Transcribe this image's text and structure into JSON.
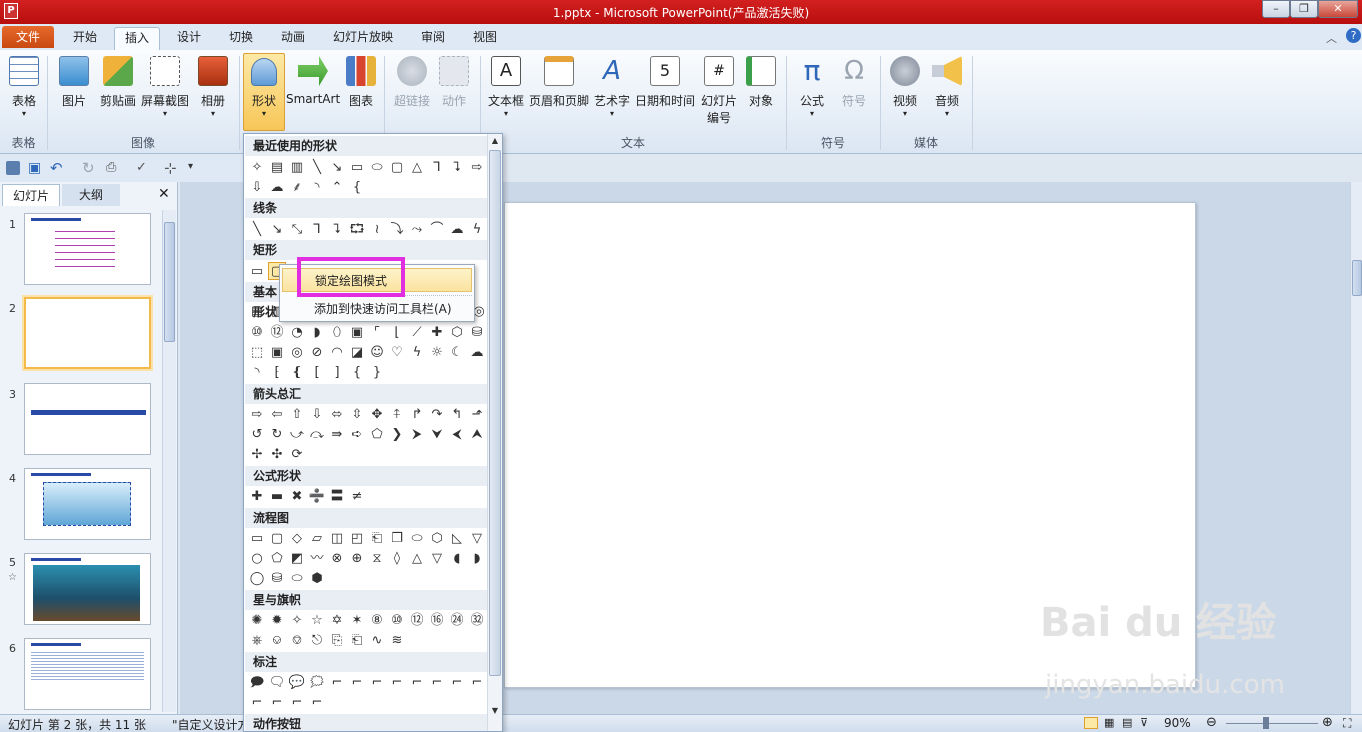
{
  "window": {
    "title": "1.pptx - Microsoft PowerPoint(产品激活失败)"
  },
  "tabs": {
    "file": "文件",
    "items": [
      "开始",
      "插入",
      "设计",
      "切换",
      "动画",
      "幻灯片放映",
      "审阅",
      "视图"
    ],
    "active": "插入"
  },
  "ribbon": {
    "buttons": {
      "table": "表格",
      "picture": "图片",
      "clipart": "剪贴画",
      "screenshot": "屏幕截图",
      "album": "相册",
      "shapes": "形状",
      "smartart": "SmartArt",
      "chart": "图表",
      "hyperlink": "超链接",
      "action": "动作",
      "textbox": "文本框",
      "headerfooter": "页眉和页脚",
      "wordart": "艺术字",
      "datetime": "日期和时间",
      "slidenum1": "幻灯片",
      "slidenum2": "编号",
      "object": "对象",
      "equation": "公式",
      "symbol": "符号",
      "video": "视频",
      "audio": "音频"
    },
    "groups": {
      "table": "表格",
      "image": "图像",
      "text": "文本",
      "symbols": "符号",
      "media": "媒体"
    }
  },
  "left_pane": {
    "tab_slides": "幻灯片",
    "tab_outline": "大纲",
    "slides": [
      "1",
      "2",
      "3",
      "4",
      "5",
      "6"
    ]
  },
  "gallery": {
    "sections": [
      "最近使用的形状",
      "线条",
      "矩形",
      "基本形状",
      "箭头总汇",
      "公式形状",
      "流程图",
      "星与旗帜",
      "标注",
      "动作按钮"
    ]
  },
  "context_menu": {
    "lock": "锁定绘图模式",
    "add_qat": "添加到快速访问工具栏(A)"
  },
  "status": {
    "slide_info": "幻灯片 第 2 张，共 11 张",
    "theme": "\"自定义设计方",
    "zoom": "90%"
  },
  "watermark": {
    "brand": "Bai du 经验",
    "url": "jingyan.baidu.com"
  }
}
